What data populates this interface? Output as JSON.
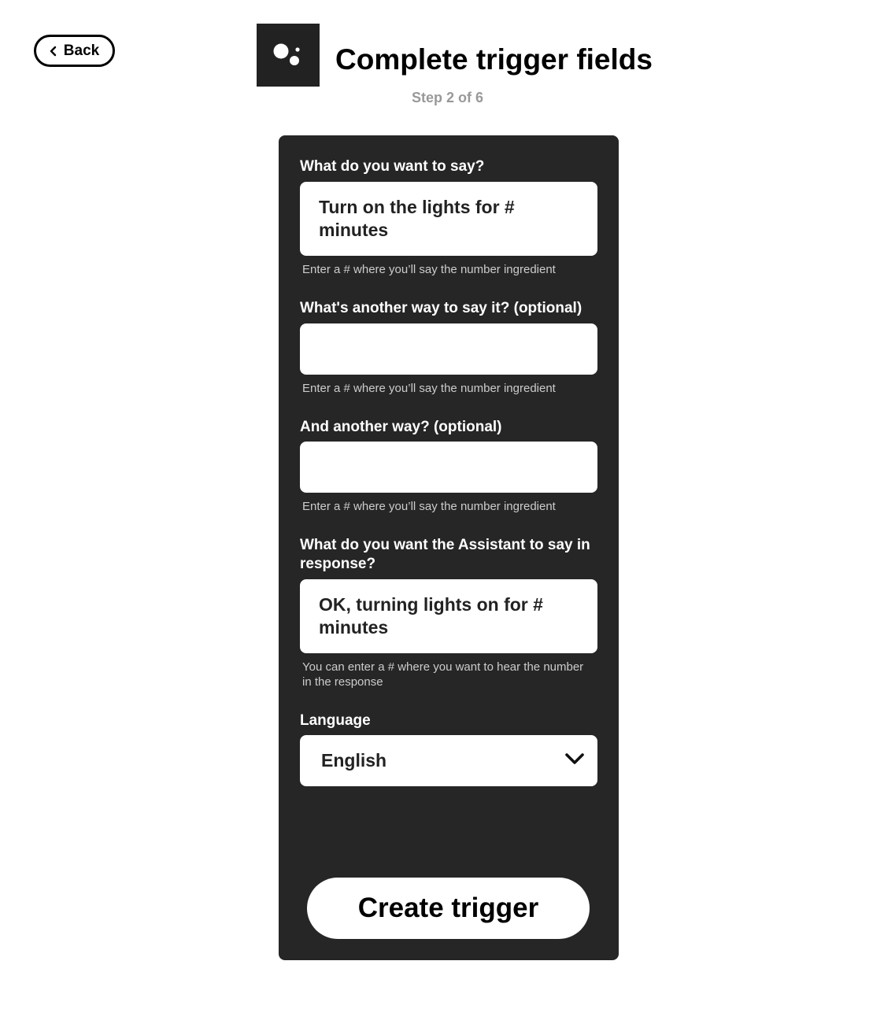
{
  "header": {
    "back_label": "Back",
    "title": "Complete trigger fields",
    "step": "Step 2 of 6",
    "logo_icon": "google-assistant-icon"
  },
  "form": {
    "fields": [
      {
        "label": "What do you want to say?",
        "value": "Turn on the lights for # minutes",
        "helper": "Enter a # where you’ll say the number ingredient"
      },
      {
        "label": "What's another way to say it? (optional)",
        "value": "",
        "helper": "Enter a # where you’ll say the number ingredient"
      },
      {
        "label": "And another way? (optional)",
        "value": "",
        "helper": "Enter a # where you’ll say the number ingredient"
      },
      {
        "label": "What do you want the Assistant to say in response?",
        "value": "OK, turning lights on for # minutes",
        "helper": "You can enter a # where you want to hear the number in the response"
      }
    ],
    "language": {
      "label": "Language",
      "selected": "English"
    },
    "submit_label": "Create trigger"
  },
  "colors": {
    "card_background": "#262626",
    "logo_background": "#222222",
    "step_text": "#999999",
    "helper_text": "#cccccc"
  }
}
